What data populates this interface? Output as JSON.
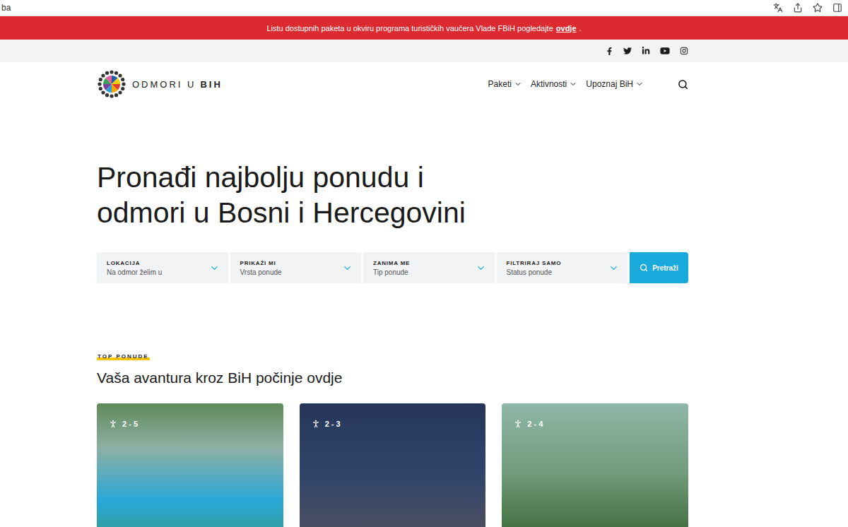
{
  "browser": {
    "url": "ba"
  },
  "banner": {
    "text": "Listu dostupnih paketa u okviru programa turističkih vaučera Vlade FBiH pogledajte",
    "link": "ovdje",
    "after": "."
  },
  "logo": {
    "text": "ODMORI U",
    "bold": "BIH"
  },
  "nav": [
    {
      "label": "Paketi"
    },
    {
      "label": "Aktivnosti"
    },
    {
      "label": "Upoznaj BiH"
    }
  ],
  "hero": {
    "lines": [
      "Pronađi najbolju ponudu i",
      "odmori u Bosni i Hercegovini"
    ]
  },
  "search": {
    "fields": [
      {
        "label": "LOKACIJA",
        "placeholder": "Na odmor želim u"
      },
      {
        "label": "PRIKAŽI MI",
        "placeholder": "Vrsta ponude"
      },
      {
        "label": "ZANIMA ME",
        "placeholder": "Tip ponude"
      },
      {
        "label": "FILTRIRAJ SAMO",
        "placeholder": "Status ponude"
      }
    ],
    "button": "Pretraži"
  },
  "section": {
    "eyebrow": "TOP PONUDE",
    "title": "Vaša avantura kroz BiH počinje ovdje"
  },
  "cards": [
    {
      "guests": "2 - 5"
    },
    {
      "guests": "2 - 3"
    },
    {
      "guests": "2 - 4"
    }
  ]
}
